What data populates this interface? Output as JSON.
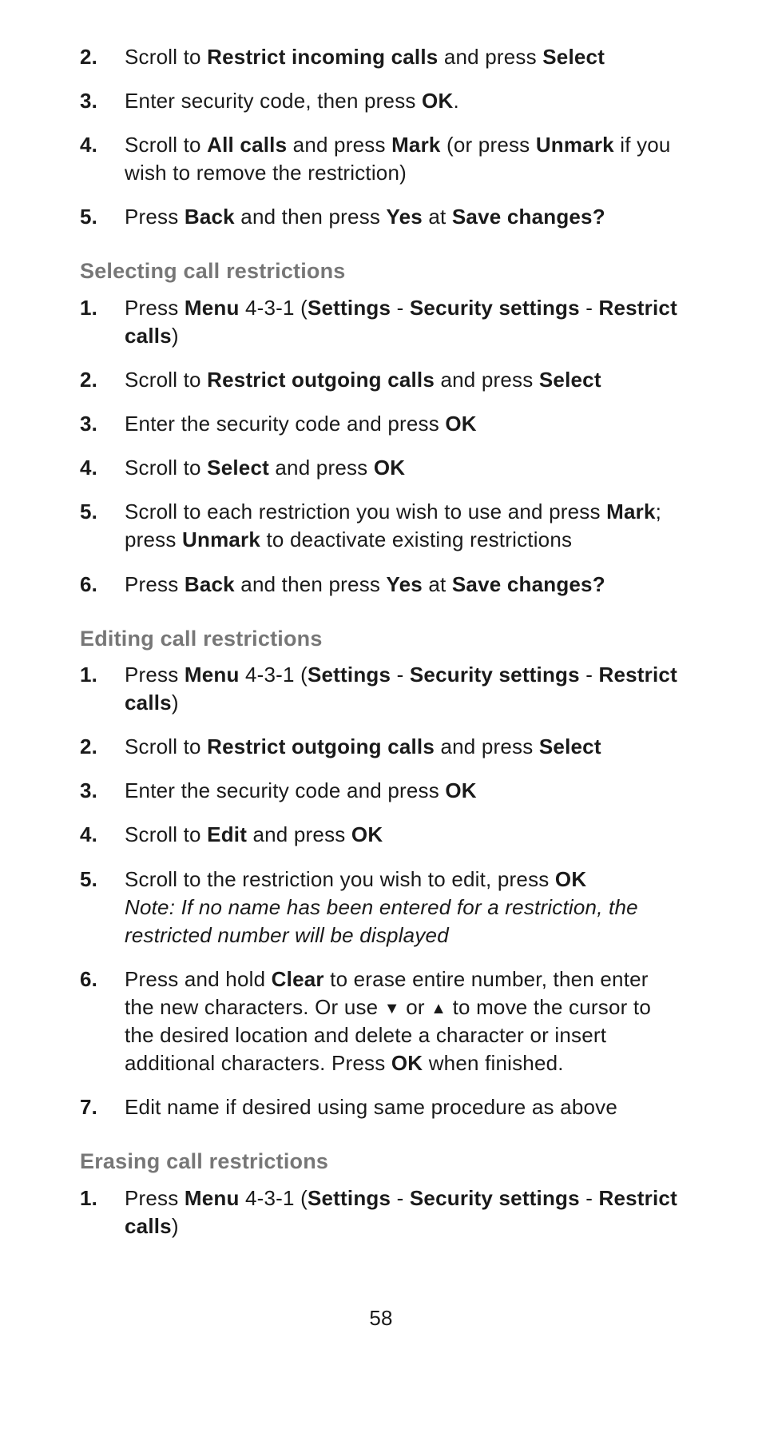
{
  "page_number": "58",
  "top_steps": [
    {
      "n": "2.",
      "parts": [
        "Scroll to ",
        {
          "b": "Restrict incoming calls"
        },
        " and press ",
        {
          "b": "Select"
        }
      ]
    },
    {
      "n": "3.",
      "parts": [
        "Enter security code, then press ",
        {
          "b": "OK"
        },
        "."
      ]
    },
    {
      "n": "4.",
      "parts": [
        "Scroll to ",
        {
          "b": "All calls"
        },
        " and press ",
        {
          "b": "Mark"
        },
        " (or press ",
        {
          "b": "Unmark"
        },
        " if you wish to remove the restriction)"
      ]
    },
    {
      "n": "5.",
      "parts": [
        "Press ",
        {
          "b": "Back"
        },
        " and then press ",
        {
          "b": "Yes"
        },
        " at ",
        {
          "b": "Save changes?"
        }
      ]
    }
  ],
  "sections": [
    {
      "heading": "Selecting call restrictions",
      "steps": [
        {
          "n": "1.",
          "parts": [
            "Press ",
            {
              "b": "Menu"
            },
            " 4-3-1 (",
            {
              "b": "Settings"
            },
            " - ",
            {
              "b": "Security settings"
            },
            " - ",
            {
              "b": "Restrict calls"
            },
            ")"
          ]
        },
        {
          "n": "2.",
          "parts": [
            "Scroll to ",
            {
              "b": "Restrict outgoing calls"
            },
            " and press ",
            {
              "b": "Select"
            }
          ]
        },
        {
          "n": "3.",
          "parts": [
            "Enter the security code and press ",
            {
              "b": "OK"
            }
          ]
        },
        {
          "n": "4.",
          "parts": [
            "Scroll to ",
            {
              "b": "Select"
            },
            " and press ",
            {
              "b": "OK"
            }
          ]
        },
        {
          "n": "5.",
          "parts": [
            "Scroll to each restriction you wish to use and press ",
            {
              "b": "Mark"
            },
            "; press ",
            {
              "b": "Unmark"
            },
            " to deactivate existing restrictions"
          ]
        },
        {
          "n": "6.",
          "parts": [
            "Press ",
            {
              "b": "Back"
            },
            " and then press ",
            {
              "b": "Yes"
            },
            " at ",
            {
              "b": "Save changes?"
            }
          ]
        }
      ]
    },
    {
      "heading": "Editing call restrictions",
      "steps": [
        {
          "n": "1.",
          "parts": [
            "Press ",
            {
              "b": "Menu"
            },
            " 4-3-1 (",
            {
              "b": "Settings"
            },
            " - ",
            {
              "b": "Security settings"
            },
            " - ",
            {
              "b": "Restrict calls"
            },
            ")"
          ]
        },
        {
          "n": "2.",
          "parts": [
            "Scroll to ",
            {
              "b": "Restrict outgoing calls"
            },
            " and press ",
            {
              "b": "Select"
            }
          ]
        },
        {
          "n": "3.",
          "parts": [
            "Enter the security code and press ",
            {
              "b": "OK"
            }
          ]
        },
        {
          "n": "4.",
          "parts": [
            "Scroll to ",
            {
              "b": "Edit"
            },
            " and press ",
            {
              "b": "OK"
            }
          ]
        },
        {
          "n": "5.",
          "parts": [
            "Scroll to the restriction you wish to edit, press ",
            {
              "b": "OK"
            }
          ],
          "note": "Note: If no name has been entered for a restriction, the restricted number will be displayed"
        },
        {
          "n": "6.",
          "parts": [
            "Press and hold ",
            {
              "b": "Clear"
            },
            " to erase entire number, then enter the new characters. Or use ",
            {
              "icon": "down"
            },
            " or ",
            {
              "icon": "up"
            },
            " to move the cursor to the desired location and delete a character or insert additional characters. Press ",
            {
              "b": "OK"
            },
            " when finished."
          ]
        },
        {
          "n": "7.",
          "parts": [
            "Edit name if desired using same procedure as above"
          ]
        }
      ]
    },
    {
      "heading": "Erasing call restrictions",
      "steps": [
        {
          "n": "1.",
          "parts": [
            "Press ",
            {
              "b": "Menu"
            },
            " 4-3-1 (",
            {
              "b": "Settings"
            },
            " - ",
            {
              "b": "Security settings"
            },
            " - ",
            {
              "b": "Restrict calls"
            },
            ")"
          ]
        }
      ]
    }
  ]
}
